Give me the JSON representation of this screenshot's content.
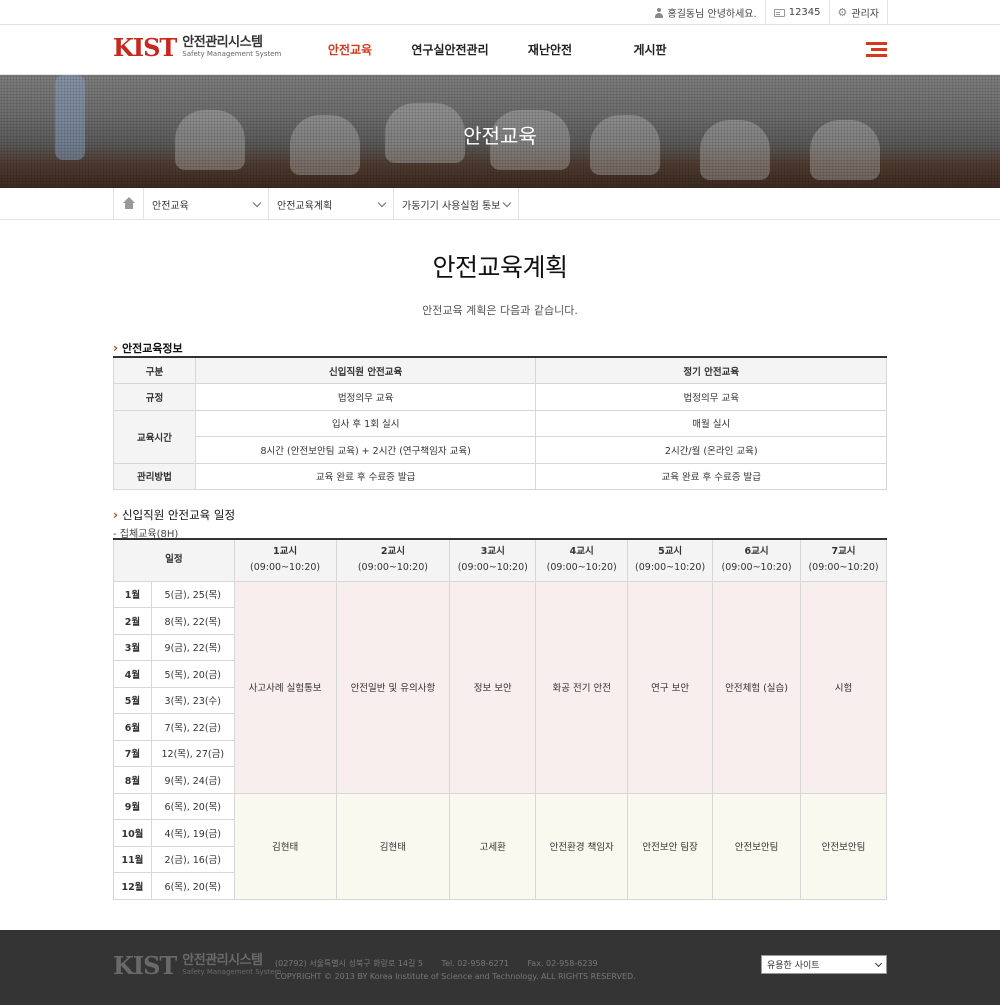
{
  "topbar": {
    "greeting": "홍길동님 안녕하세요.",
    "number": "12345",
    "admin": "관리자"
  },
  "header": {
    "logo_mark": "KIST",
    "logo_ko": "안전관리시스템",
    "logo_en": "Safety Management System",
    "nav": [
      "안전교육",
      "연구실안전관리",
      "재난안전",
      "게시판"
    ]
  },
  "banner": {
    "title": "안전교육"
  },
  "location": {
    "items": [
      "안전교육",
      "안전교육계획",
      "가동기기 사용실험 통보"
    ]
  },
  "page": {
    "title": "안전교육계획",
    "desc": "안전교육 계획은 다음과 같습니다."
  },
  "section1": {
    "title": "안전교육정보",
    "headers": [
      "구분",
      "신입직원 안전교육",
      "정기 안전교육"
    ],
    "rows": {
      "rule": [
        "규정",
        "법정의무 교육",
        "법정의무 교육"
      ],
      "time_label": "교육시간",
      "time1": [
        "입사 후 1회 실시",
        "매월 실시"
      ],
      "time2": [
        "8시간 (안전보안팀 교육) + 2시간 (연구책임자 교육)",
        "2시간/월 (온라인 교육)"
      ],
      "manage": [
        "관리방법",
        "교육 완료 후 수료증 발급",
        "교육 완료 후 수료증 발급"
      ]
    }
  },
  "section2": {
    "title": "신입직원 안전교육 일정",
    "sub": "- 집체교육(8H)",
    "schedule_header": "일정",
    "periods": [
      {
        "name": "1교시",
        "time": "(09:00~10:20)"
      },
      {
        "name": "2교시",
        "time": "(09:00~10:20)"
      },
      {
        "name": "3교시",
        "time": "(09:00~10:20)"
      },
      {
        "name": "4교시",
        "time": "(09:00~10:20)"
      },
      {
        "name": "5교시",
        "time": "(09:00~10:20)"
      },
      {
        "name": "6교시",
        "time": "(09:00~10:20)"
      },
      {
        "name": "7교시",
        "time": "(09:00~10:20)"
      }
    ],
    "months": [
      {
        "month": "1월",
        "dates": "5(금), 25(목)"
      },
      {
        "month": "2월",
        "dates": "8(목), 22(목)"
      },
      {
        "month": "3월",
        "dates": "9(금), 22(목)"
      },
      {
        "month": "4월",
        "dates": "5(목), 20(금)"
      },
      {
        "month": "5월",
        "dates": "3(목), 23(수)"
      },
      {
        "month": "6월",
        "dates": "7(목), 22(금)"
      },
      {
        "month": "7월",
        "dates": "12(목), 27(금)"
      },
      {
        "month": "8월",
        "dates": "9(목), 24(금)"
      },
      {
        "month": "9월",
        "dates": "6(목), 20(목)"
      },
      {
        "month": "10월",
        "dates": "4(목), 19(금)"
      },
      {
        "month": "11월",
        "dates": "2(금), 16(금)"
      },
      {
        "month": "12월",
        "dates": "6(목), 20(목)"
      }
    ],
    "subjects": [
      "사고사례 실험통보",
      "안전일반 및 유의사항",
      "정보 보안",
      "화공 전기 안전",
      "연구 보안",
      "안전체험 (실습)",
      "시험"
    ],
    "instructors": [
      "김현태",
      "김현태",
      "고세환",
      "안전환경 책임자",
      "안전보안 팀장",
      "안전보안팀",
      "안전보안팀"
    ]
  },
  "footer": {
    "address": "(02792) 서울특별시 성북구 화랑로 14길 5",
    "tel": "Tel. 02-958-6271",
    "fax": "Fax. 02-958-6239",
    "copyright": "COPYRIGHT © 2013 BY Korea Institute of Science and Technology. ALL RIGHTS RESERVED.",
    "select_label": "유용한 사이트"
  },
  "colors": {
    "accent": "#d6381e",
    "pink_cell": "#f9eeee",
    "cream_cell": "#f9f9ef",
    "footer_bg": "#343434"
  }
}
